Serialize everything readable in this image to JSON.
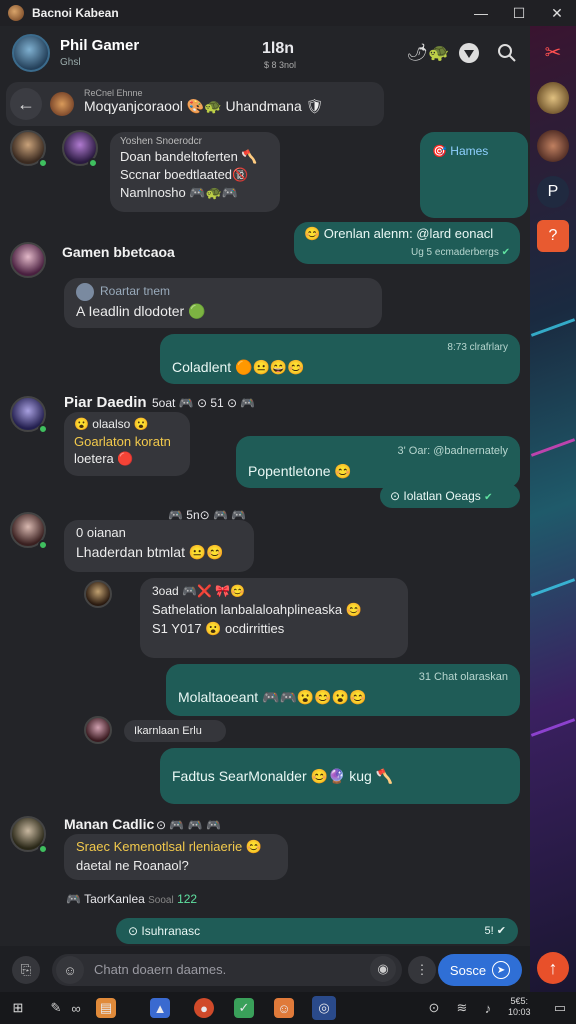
{
  "window": {
    "title": "Bacnoi Kabean",
    "minimize": "—",
    "maximize": "☐",
    "close": "✕"
  },
  "header": {
    "name": "Phil Gamer",
    "sub": "Ghsl",
    "center_title": "1l8n",
    "center_sub": "$ 8 3nol"
  },
  "pinned": {
    "label": "ReCnel Ehnne",
    "text": "Moqyanjcoraool 🎨🐢 Uhandmana 🛡"
  },
  "messages": [
    {
      "kind": "in",
      "lines": [
        "Yoshen Snoerodcr",
        "Doan bandeltoferten 🪓",
        "Sccnar boedtlaated🔞",
        "Namlnosho 🎮🐢🎮"
      ]
    },
    {
      "kind": "out",
      "lines": [
        "🎯 Hames"
      ]
    },
    {
      "kind": "out",
      "lines": [
        "😊 Orenlan alenm: @lard eonacl",
        "Ug 5 ecmaderbergs"
      ]
    },
    {
      "kind": "name",
      "lines": [
        "Gamen bbetcaoa"
      ]
    },
    {
      "kind": "in",
      "lines": [
        "Roartar tnem",
        "A Ieadlin dlodoter 🟢"
      ]
    },
    {
      "kind": "out",
      "lines": [
        "Coladlent 🟠😐😄😊",
        "8:73 clrafrlary"
      ]
    },
    {
      "kind": "name",
      "lines": [
        "Piar Daedin"
      ]
    },
    {
      "kind": "in",
      "lines": [
        "😮 olaalso 😮",
        "Goarlaton koratn",
        "loetera 🔴"
      ]
    },
    {
      "kind": "out",
      "lines": [
        "Popentletone 😊",
        "3' Oar: @badnernately"
      ]
    },
    {
      "kind": "out",
      "lines": [
        "⊙ Iolatlan Oeags"
      ]
    },
    {
      "kind": "in",
      "lines": [
        "0 oianan",
        "Lhaderdan btmlat 😐😊"
      ]
    },
    {
      "kind": "in",
      "lines": [
        "3oad 🎮❌ 🎀😊",
        "Sathelation lanbalaloahplineaska 😊",
        "S1 Y017 😮 ocdirritties"
      ]
    },
    {
      "kind": "out",
      "lines": [
        "31 Chat olaraskan",
        "Molaltaoeant 🎮🎮😮😊😮😊"
      ]
    },
    {
      "kind": "in",
      "lines": [
        "Ikarnlaan Erlu"
      ]
    },
    {
      "kind": "out",
      "lines": [
        "Fadtus SearMonalder 😊🔮 kug 🪓"
      ]
    },
    {
      "kind": "name",
      "lines": [
        "Manan Cadlic"
      ]
    },
    {
      "kind": "in",
      "lines": [
        "Sraec Kemenotlsal rleniaerie 😊",
        "daetal ne Roanaol?"
      ]
    },
    {
      "kind": "meta",
      "lines": [
        "TaorKanlea",
        "Sooal",
        "122"
      ]
    },
    {
      "kind": "out",
      "lines": [
        "⊙ Isuhranasc",
        "5! ✔"
      ]
    }
  ],
  "name_extras": [
    {
      "text": "5oat 🎮 ⊙ 51 ⊙ 🎮"
    },
    {
      "text": "🎮 5n⊙ 🎮 🎮"
    }
  ],
  "composer": {
    "placeholder": "Chatn doaern daames.",
    "send_label": "Sosce",
    "fab": "↑"
  },
  "taskbar": {
    "time_line1": "5€5:",
    "time_line2": "10:03"
  },
  "colors": {
    "outgoing": "#1f5c57",
    "incoming": "#35363b",
    "accent": "#2f6fd6",
    "fab": "#e8502a"
  }
}
